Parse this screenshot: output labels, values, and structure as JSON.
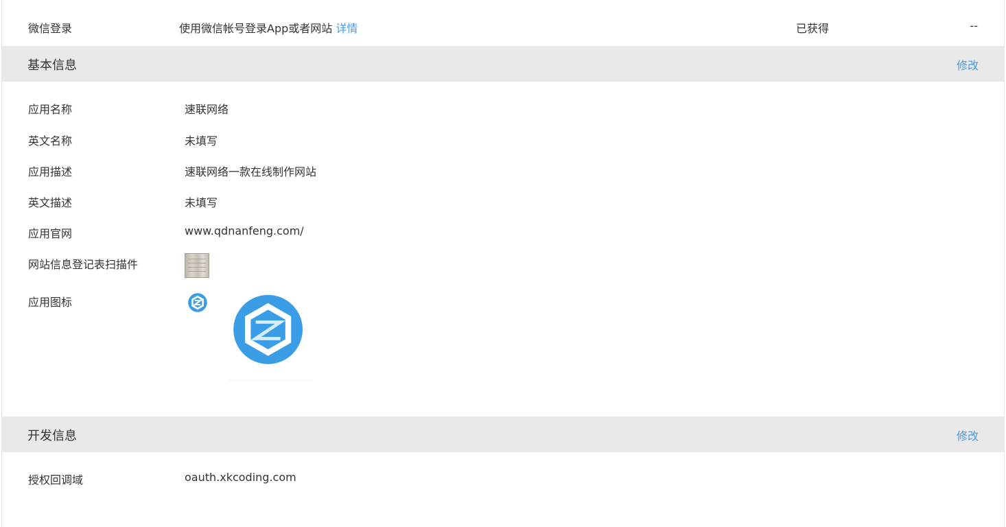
{
  "permission": {
    "name": "微信登录",
    "description": "使用微信帐号登录App或者网站",
    "detail_link": "详情",
    "status": "已获得",
    "extra": "--"
  },
  "basic_info": {
    "title": "基本信息",
    "edit_label": "修改",
    "rows": [
      {
        "label": "应用名称",
        "value": "速联网络"
      },
      {
        "label": "英文名称",
        "value": "未填写"
      },
      {
        "label": "应用描述",
        "value": "速联网络一款在线制作网站"
      },
      {
        "label": "英文描述",
        "value": "未填写"
      },
      {
        "label": "应用官网",
        "value": "www.qdnanfeng.com/"
      }
    ],
    "scan_label": "网站信息登记表扫描件",
    "icon_label": "应用图标",
    "icon_color": "#3b9de6"
  },
  "dev_info": {
    "title": "开发信息",
    "edit_label": "修改",
    "rows": [
      {
        "label": "授权回调域",
        "value": "oauth.xkcoding.com"
      }
    ]
  },
  "colors": {
    "link": "#459ae9",
    "header_bg": "#e9e9e9",
    "text": "#333333"
  }
}
